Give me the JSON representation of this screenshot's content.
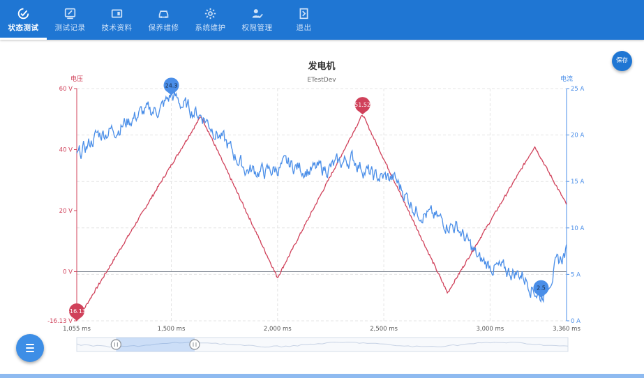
{
  "nav": {
    "tabs": [
      {
        "label": "状态测试",
        "icon": "gauge-check-icon",
        "active": true
      },
      {
        "label": "测试记录",
        "icon": "edit-record-icon",
        "active": false
      },
      {
        "label": "技术资料",
        "icon": "document-panel-icon",
        "active": false
      },
      {
        "label": "保养维修",
        "icon": "car-repair-icon",
        "active": false
      },
      {
        "label": "系统维护",
        "icon": "gear-icon",
        "active": false
      },
      {
        "label": "权限管理",
        "icon": "user-check-icon",
        "active": false
      },
      {
        "label": "退出",
        "icon": "exit-door-icon",
        "active": false
      }
    ]
  },
  "actions": {
    "save_label": "保存"
  },
  "colors": {
    "primary": "#1f76d3",
    "voltage": "#d0415a",
    "current": "#4a8ee8"
  },
  "chart_data": {
    "type": "line",
    "title": "发电机",
    "subtitle": "ETestDev",
    "x_ticks": [
      "1,055 ms",
      "1,500 ms",
      "2,000 ms",
      "2,500 ms",
      "3,000 ms",
      "3,360 ms"
    ],
    "xlim": [
      1055,
      3360
    ],
    "left_axis": {
      "label": "电压",
      "ticks": [
        "60 V",
        "40 V",
        "20 V",
        "0 V",
        "-16.13 V"
      ],
      "ylim": [
        -16.13,
        60
      ]
    },
    "right_axis": {
      "label": "电流",
      "ticks": [
        "25 A",
        "20 A",
        "15 A",
        "10 A",
        "5 A",
        "0 A"
      ],
      "ylim": [
        0,
        25
      ]
    },
    "series": [
      {
        "name": "电压",
        "axis": "left",
        "x": [
          1055,
          1640,
          2000,
          2400,
          2800,
          3210,
          3360
        ],
        "y": [
          -16.13,
          51.0,
          -2.0,
          51.52,
          -7.0,
          41.0,
          22.0
        ]
      },
      {
        "name": "电流",
        "axis": "right",
        "x": [
          1055,
          1150,
          1250,
          1350,
          1450,
          1500,
          1550,
          1650,
          1750,
          1850,
          1950,
          2050,
          2150,
          2250,
          2350,
          2450,
          2550,
          2650,
          2750,
          2850,
          2950,
          3050,
          3150,
          3240,
          3300,
          3360
        ],
        "y": [
          17.5,
          20.0,
          20.8,
          22.3,
          22.8,
          24.3,
          23.3,
          22.0,
          19.3,
          16.3,
          16.0,
          16.8,
          16.2,
          16.5,
          17.5,
          15.5,
          15.3,
          12.0,
          11.0,
          10.0,
          6.5,
          5.5,
          5.0,
          2.5,
          5.5,
          7.5
        ]
      }
    ],
    "markers": [
      {
        "series": "电流",
        "label": "24.3",
        "x": 1500,
        "y": 24.3
      },
      {
        "series": "电流",
        "label": "2.5",
        "x": 3240,
        "y": 2.5
      },
      {
        "series": "电压",
        "label": "51.52",
        "x": 2400,
        "y": 51.52
      },
      {
        "series": "电压",
        "label": "-16.13",
        "x": 1055,
        "y": -16.13
      }
    ],
    "grid": true,
    "zoom_range": [
      0.08,
      0.24
    ]
  }
}
